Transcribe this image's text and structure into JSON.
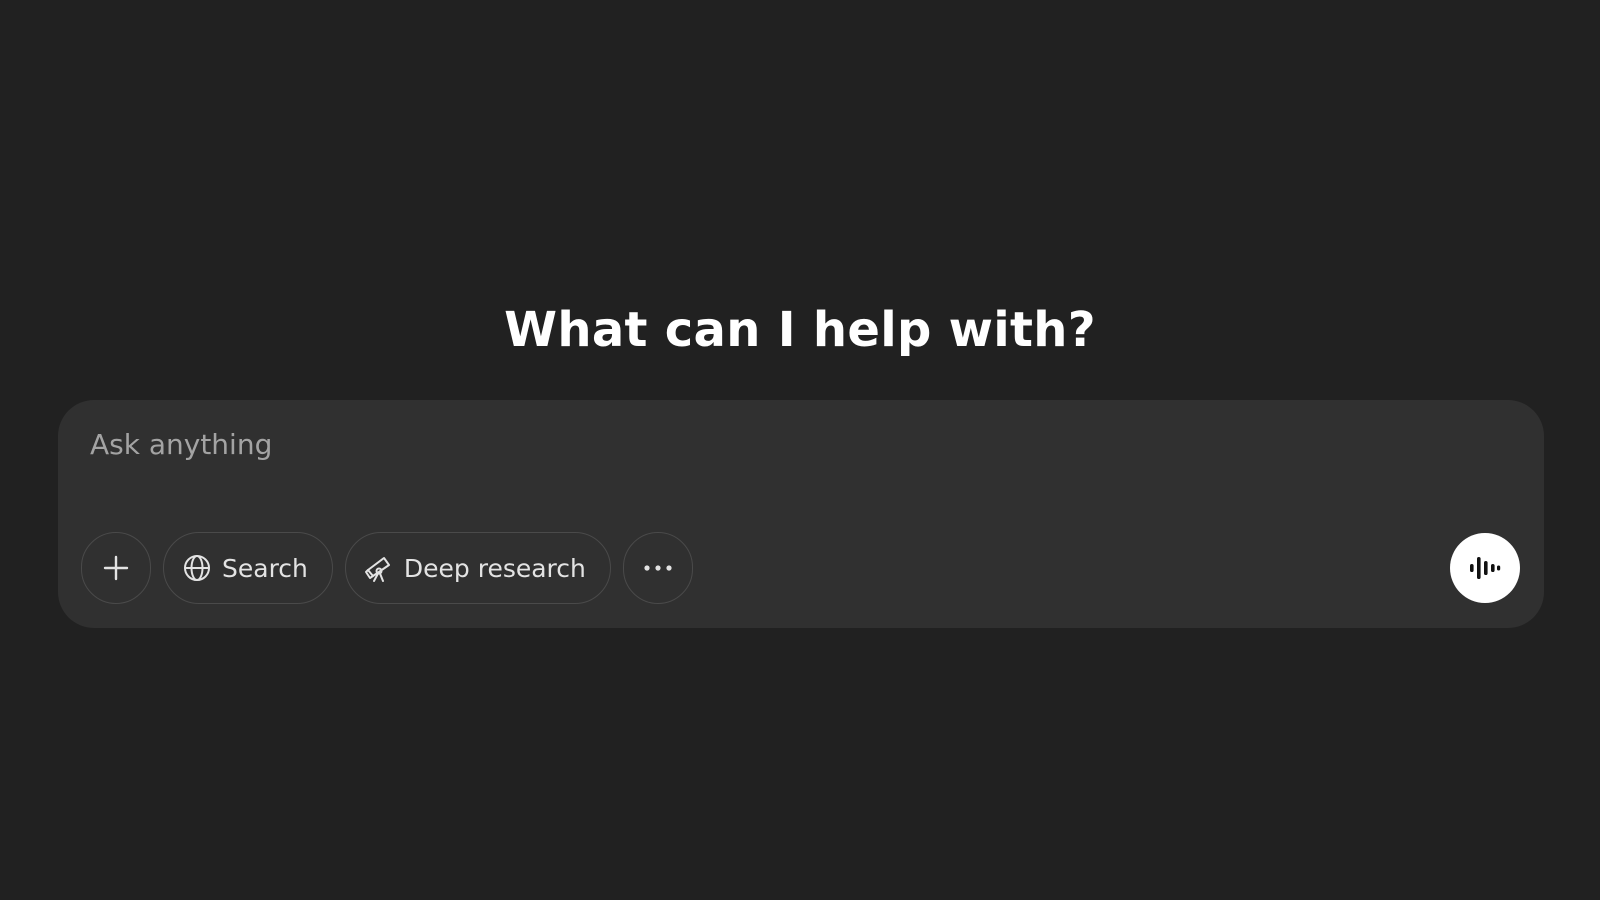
{
  "main": {
    "heading": "What can I help with?"
  },
  "composer": {
    "placeholder": "Ask anything",
    "value": "",
    "buttons": {
      "add": {
        "icon": "plus-icon"
      },
      "search": {
        "label": "Search",
        "icon": "globe-icon"
      },
      "deep_research": {
        "label": "Deep research",
        "icon": "telescope-icon"
      },
      "more": {
        "icon": "ellipsis-icon"
      },
      "voice": {
        "icon": "voice-waveform-icon"
      }
    }
  },
  "colors": {
    "background": "#212121",
    "composer_background": "#303030",
    "pill_border": "#4a4a4a",
    "heading_text": "#ffffff",
    "placeholder_text": "#a3a3a3",
    "voice_button_background": "#ffffff"
  }
}
